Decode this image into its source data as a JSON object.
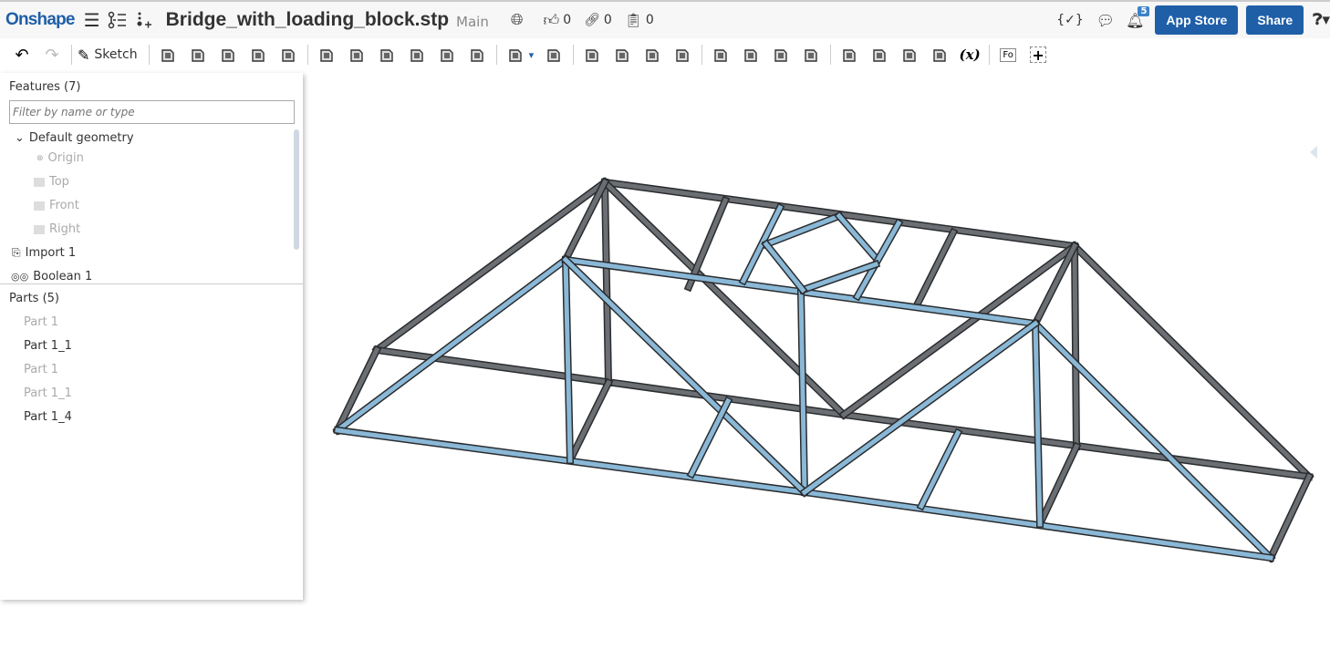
{
  "topbar": {
    "logo": "Onshape",
    "doc_title": "Bridge_with_loading_block.stp",
    "branch": "Main",
    "likes": "0",
    "links": "0",
    "copies": "0",
    "notif_count": "5",
    "app_store": "App Store",
    "share": "Share"
  },
  "toolbar": {
    "sketch": "Sketch",
    "fo": "Fo"
  },
  "features": {
    "header": "Features (7)",
    "filter_placeholder": "Filter by name or type",
    "default_geometry": "Default geometry",
    "items": [
      "Origin",
      "Top",
      "Front",
      "Right"
    ],
    "import": "Import 1",
    "boolean": "Boolean 1"
  },
  "parts": {
    "header": "Parts (5)",
    "items": [
      {
        "label": "Part 1"
      },
      {
        "label": "Part 1_1"
      },
      {
        "label": "Part 1"
      },
      {
        "label": "Part 1_1"
      },
      {
        "label": "Part 1_4"
      }
    ]
  },
  "colors": {
    "accent": "#1f5fa8",
    "blue_member": "#8ab8d6",
    "gray_member": "#6b6e72"
  }
}
